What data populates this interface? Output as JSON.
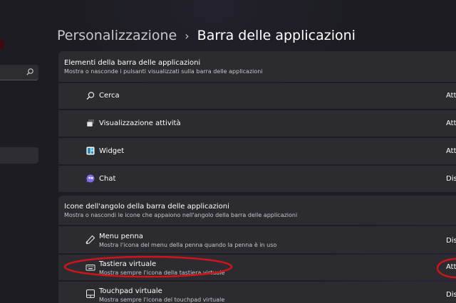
{
  "header": {
    "parent": "Personalizzazione",
    "separator": "›",
    "current": "Barra delle applicazioni"
  },
  "sections": [
    {
      "title": "Elementi della barra delle applicazioni",
      "description": "Mostra o nasconde i pulsanti visualizzati sulla barra delle applicazioni",
      "items": [
        {
          "label": "Cerca",
          "value": "Attivato",
          "icon": "search-icon"
        },
        {
          "label": "Visualizzazione attività",
          "value": "Attivato",
          "icon": "task-view-icon"
        },
        {
          "label": "Widget",
          "value": "Attivato",
          "icon": "widgets-icon"
        },
        {
          "label": "Chat",
          "value": "Disattivato",
          "icon": "chat-icon"
        }
      ]
    },
    {
      "title": "Icone dell'angolo della barra delle applicazioni",
      "description": "Mostra o nascondi le icone che appaiono nell'angolo della barra delle applicazioni",
      "items": [
        {
          "label": "Menu penna",
          "sub": "Mostra l'icona del menu della penna quando la penna è in uso",
          "value": "Disattivato",
          "icon": "pen-icon"
        },
        {
          "label": "Tastiera virtuale",
          "sub": "Mostra sempre l'icona della tastiera virtuale",
          "value": "Attivato",
          "icon": "keyboard-icon"
        },
        {
          "label": "Touchpad virtuale",
          "sub": "Mostra sempre l'icona del touchpad virtuale",
          "value": "Disattivato",
          "icon": "touchpad-icon"
        }
      ]
    }
  ],
  "annotation_color": "#d0141c"
}
